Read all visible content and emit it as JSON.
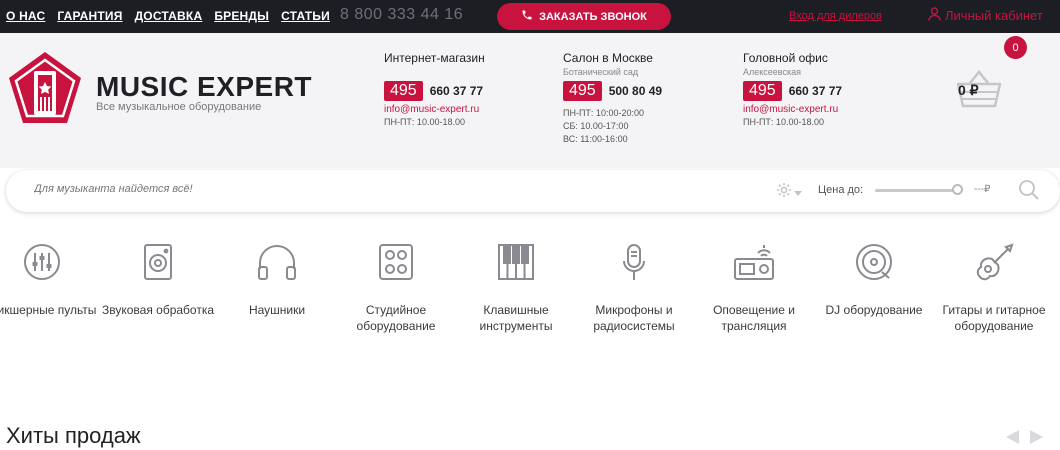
{
  "topnav": {
    "links": [
      "О НАС",
      "ГАРАНТИЯ",
      "ДОСТАВКА",
      "БРЕНДЫ",
      "СТАТЬИ"
    ],
    "phone": "8 800 333 44 16",
    "callback_label": "ЗАКАЗАТЬ ЗВОНОК",
    "dealers_label": "Вход для дилеров",
    "cabinet_label": "Личный кабинет"
  },
  "brand": {
    "name": "MUSIC EXPERT",
    "tagline": "Все музыкальное оборудование"
  },
  "contacts": [
    {
      "title": "Интернет-магазин",
      "subtitle": "",
      "code": "495",
      "number": "660 37 77",
      "email": "info@music-expert.ru",
      "hours": [
        "ПН-ПТ: 10.00-18.00"
      ]
    },
    {
      "title": "Салон в Москве",
      "subtitle": "Ботанический сад",
      "code": "495",
      "number": "500 80 49",
      "email": "",
      "hours": [
        "ПН-ПТ: 10:00-20:00",
        "СБ: 10.00-17:00",
        "ВС: 11:00-16:00"
      ]
    },
    {
      "title": "Головной офис",
      "subtitle": "Алексеевская",
      "code": "495",
      "number": "660 37 77",
      "email": "info@music-expert.ru",
      "hours": [
        "ПН-ПТ: 10.00-18.00"
      ]
    }
  ],
  "cart": {
    "count": "0",
    "total": "0 ₽"
  },
  "search": {
    "placeholder": "Для музыканта найдется всё!",
    "price_label": "Цена до:",
    "price_value": "---₽"
  },
  "categories": [
    {
      "icon": "mixer-icon",
      "label": "Микшерные пульты"
    },
    {
      "icon": "speaker-processing-icon",
      "label": "Звуковая обработка"
    },
    {
      "icon": "headphones-icon",
      "label": "Наушники"
    },
    {
      "icon": "studio-icon",
      "label": "Студийное оборудование"
    },
    {
      "icon": "piano-icon",
      "label": "Клавишные инструменты"
    },
    {
      "icon": "microphone-icon",
      "label": "Микрофоны и радиосистемы"
    },
    {
      "icon": "broadcast-icon",
      "label": "Оповещение и трансляция"
    },
    {
      "icon": "dj-icon",
      "label": "DJ оборудование"
    },
    {
      "icon": "guitar-icon",
      "label": "Гитары и гитарное оборудование"
    }
  ],
  "section": {
    "title": "Хиты продаж"
  },
  "colors": {
    "accent": "#c8133f",
    "topbar": "#1d1d24",
    "header_bg": "#f4f4f6",
    "icon_gray": "#8a8a90"
  }
}
